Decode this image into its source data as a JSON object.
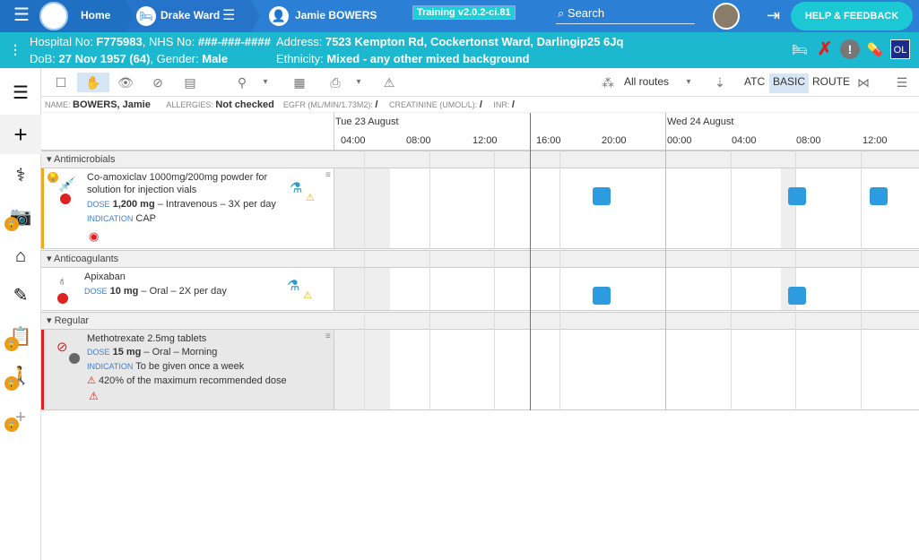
{
  "topbar": {
    "home": "Home",
    "ward": "Drake Ward",
    "patient": "Jamie BOWERS",
    "training": "Training v2.0.2-ci.81",
    "search": "Search",
    "help": "HELP & FEEDBACK"
  },
  "patient": {
    "line1a": "Hospital No: ",
    "hosp": "F775983",
    "line1b": ", NHS No: ",
    "nhs": "###-###-####",
    "line2a": "DoB: ",
    "dob": "27 Nov 1957 (64)",
    "line2b": ", Gender: ",
    "gender": "Male",
    "addr_lbl": "Address: ",
    "address": "7523 Kempton Rd, Cockertonst Ward, Darlingip25 6Jq",
    "eth_lbl": "Ethnicity: ",
    "ethnicity": "Mixed - any other mixed background",
    "ol": "OL"
  },
  "toolbar": {
    "routes": "All routes",
    "atc": "ATC",
    "basic": "BASIC",
    "route": "ROUTE"
  },
  "info": {
    "name_lbl": "NAME:",
    "name": "BOWERS, Jamie",
    "allergies_lbl": "ALLERGIES:",
    "allergies": "Not checked",
    "egfr_lbl": "EGFR (ML/MIN/1.73M2):",
    "egfr": "/",
    "creat_lbl": "CREATININE (UMOL/L):",
    "creat": "/",
    "inr_lbl": "INR:",
    "inr": "/"
  },
  "timeline": {
    "date1": "Tue 23 August",
    "date2": "Wed 24 August",
    "times": [
      "04:00",
      "08:00",
      "12:00",
      "16:00",
      "20:00",
      "00:00",
      "04:00",
      "08:00",
      "12:00"
    ]
  },
  "sections": {
    "s1": "Antimicrobials",
    "s2": "Anticoagulants",
    "s3": "Regular"
  },
  "drugs": {
    "d1": {
      "name": "Co-amoxiclav 1000mg/200mg powder for solution for injection vials",
      "dose_lbl": "DOSE",
      "dose": "1,200 mg",
      "route": " – Intravenous – 3X per day",
      "ind_lbl": "INDICATION",
      "ind": "CAP"
    },
    "d2": {
      "name": "Apixaban",
      "dose_lbl": "DOSE",
      "dose": "10 mg",
      "route": " – Oral – 2X per day"
    },
    "d3": {
      "name": "Methotrexate 2.5mg tablets",
      "dose_lbl": "DOSE",
      "dose": "15 mg",
      "route": " – Oral – Morning",
      "ind_lbl": "INDICATION",
      "ind": "To be given once a week",
      "warn": "420% of the maximum recommended dose"
    }
  }
}
